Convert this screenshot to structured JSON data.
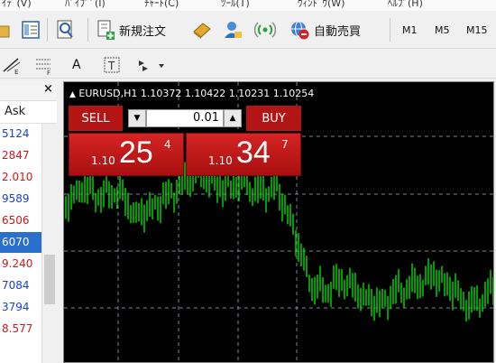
{
  "menubar": {
    "items": [
      "ｲﾃﾞ(V)",
      "ﾊﾟｲﾌﾟﾟ(I)",
      "ﾁｬｰﾄ(C)",
      "ﾂｰﾙ(T)",
      "ｳｨﾝﾄﾞｳ(W)",
      "ﾍﾙﾌﾟ(H)"
    ]
  },
  "toolbar": {
    "new_order_label": "新規注文",
    "auto_trade_label": "自動売買",
    "timeframes": [
      "M1",
      "M5",
      "M15"
    ]
  },
  "toolbar2": {
    "text_tool_label": "A"
  },
  "market_watch": {
    "close_label": "×",
    "column_header": "Ask",
    "rows": [
      {
        "value": "5124",
        "color": "#1a3fd0"
      },
      {
        "value": "2847",
        "color": "#d01818"
      },
      {
        "value": "2.010",
        "color": "#d01818"
      },
      {
        "value": "9589",
        "color": "#1a3fd0"
      },
      {
        "value": "6506",
        "color": "#d01818"
      },
      {
        "value": "6070",
        "color": "#ffffff",
        "selected": true
      },
      {
        "value": "9.240",
        "color": "#d01818"
      },
      {
        "value": "7084",
        "color": "#1a3fd0"
      },
      {
        "value": "3794",
        "color": "#1a3fd0"
      },
      {
        "value": "8.577",
        "color": "#d01818"
      }
    ]
  },
  "chart": {
    "title": "EURUSD,H1  1.10372 1.10422 1.10231 1.10254",
    "background": "#000000",
    "candle_color": "#00e000",
    "grid_color": "#7a8a99"
  },
  "one_click": {
    "sell_label": "SELL",
    "buy_label": "BUY",
    "volume": "0.01",
    "down_arrow": "▼",
    "up_arrow": "▲",
    "sell_prefix": "1.10",
    "sell_big": "25",
    "sell_sup": "4",
    "buy_prefix": "1.10",
    "buy_big": "34",
    "buy_sup": "7"
  }
}
